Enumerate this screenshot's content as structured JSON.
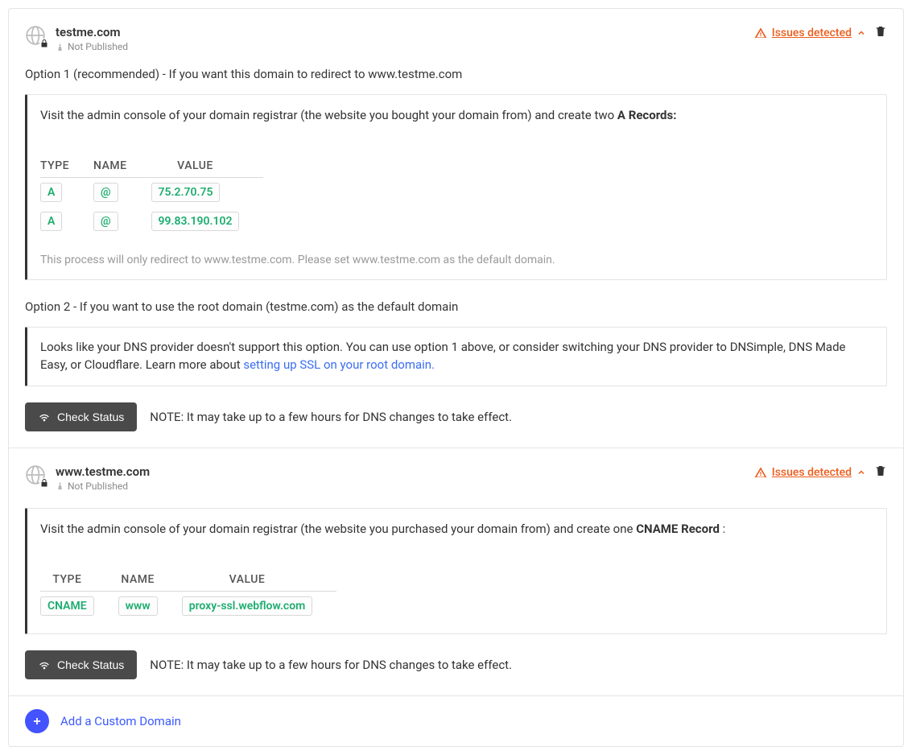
{
  "domains": [
    {
      "name": "testme.com",
      "status": "Not Published",
      "issues_label": "Issues detected",
      "option1": {
        "title": "Option 1 (recommended) - If you want this domain to redirect to www.testme.com",
        "instruction_pre": "Visit the admin console of your domain registrar (the website you bought your domain from) and create two ",
        "instruction_bold": "A Records:",
        "table_headers": {
          "type": "TYPE",
          "name": "NAME",
          "value": "VALUE"
        },
        "records": [
          {
            "type": "A",
            "name": "@",
            "value": "75.2.70.75"
          },
          {
            "type": "A",
            "name": "@",
            "value": "99.83.190.102"
          }
        ],
        "note": "This process will only redirect to www.testme.com. Please set www.testme.com as the default domain."
      },
      "option2": {
        "title": "Option 2 - If you want to use the root domain (testme.com) as the default domain",
        "text_pre": "Looks like your DNS provider doesn't support this option. You can use option 1 above, or consider switching your DNS provider to DNSimple, DNS Made Easy, or Cloudflare. Learn more about ",
        "link_text": "setting up SSL on your root domain."
      },
      "check_button": "Check Status",
      "action_note": "NOTE: It may take up to a few hours for DNS changes to take effect."
    },
    {
      "name": "www.testme.com",
      "status": "Not Published",
      "issues_label": "Issues detected",
      "cname": {
        "instruction_pre": "Visit the admin console of your domain registrar (the website you purchased your domain from) and create one ",
        "instruction_bold": "CNAME Record",
        "instruction_post": " :",
        "table_headers": {
          "type": "TYPE",
          "name": "NAME",
          "value": "VALUE"
        },
        "records": [
          {
            "type": "CNAME",
            "name": "www",
            "value": "proxy-ssl.webflow.com"
          }
        ]
      },
      "check_button": "Check Status",
      "action_note": "NOTE: It may take up to a few hours for DNS changes to take effect."
    }
  ],
  "add_label": "Add a Custom Domain"
}
